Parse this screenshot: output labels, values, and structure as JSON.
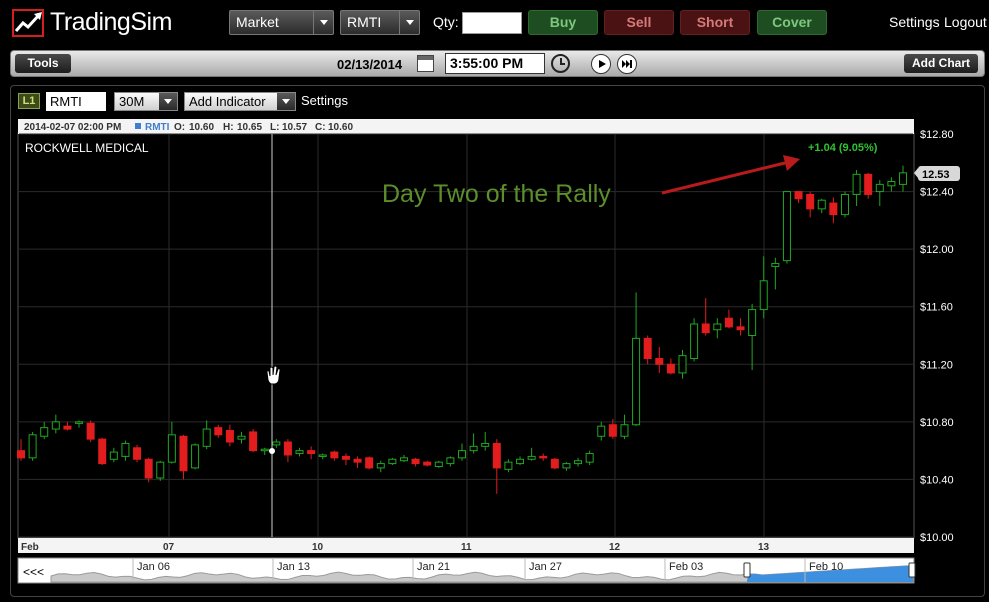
{
  "app": {
    "logo_text": "TradingSim"
  },
  "topbar": {
    "order_type": "Market",
    "symbol": "RMTI",
    "qty_label": "Qty:",
    "qty_value": "",
    "buy_label": "Buy",
    "sell_label": "Sell",
    "short_label": "Short",
    "cover_label": "Cover",
    "settings_label": "Settings",
    "logout_label": "Logout"
  },
  "toolbar": {
    "tools_label": "Tools",
    "date": "02/13/2014",
    "time": "3:55:00 PM",
    "add_chart_label": "Add Chart"
  },
  "chart_controls": {
    "level_badge": "L1",
    "symbol": "RMTI",
    "interval": "30M",
    "add_indicator_label": "Add Indicator",
    "settings_label": "Settings"
  },
  "chart_info": {
    "datetime": "2014-02-07 02:00 PM",
    "symbol": "RMTI",
    "open_label": "O:",
    "open": "10.60",
    "high_label": "H:",
    "high": "10.65",
    "low_label": "L:",
    "low": "10.57",
    "close_label": "C:",
    "close": "10.60",
    "company_name": "ROCKWELL MEDICAL",
    "change_text": "+1.04 (9.05%)",
    "last_price": "12.53",
    "annotation": "Day Two of the Rally"
  },
  "navigator": {
    "back_label": "<<<",
    "labels": [
      "Jan 06",
      "Jan 13",
      "Jan 21",
      "Jan 27",
      "Feb 03",
      "Feb 10"
    ]
  },
  "colors": {
    "up_candle": "#1fa81f",
    "down_candle": "#e21d1d",
    "annotation_green": "#5c8f2c",
    "arrow_red": "#b81b1b",
    "change_green": "#2ec42e",
    "grid": "#2b2b2b",
    "navigator_fill": "#3d8fe0"
  },
  "chart_data": {
    "type": "candlestick",
    "ylabel": "",
    "ylim": [
      10.0,
      12.8
    ],
    "y_ticks": [
      "$12.80",
      "$12.40",
      "$12.00",
      "$11.60",
      "$11.20",
      "$10.80",
      "$10.40",
      "$10.00"
    ],
    "x_ticks": [
      "Feb",
      "07",
      "10",
      "11",
      "12",
      "13"
    ],
    "grid": true,
    "candles": [
      [
        10.6,
        10.68,
        10.53,
        10.55
      ],
      [
        10.55,
        10.73,
        10.53,
        10.71
      ],
      [
        10.7,
        10.8,
        10.68,
        10.76
      ],
      [
        10.75,
        10.85,
        10.72,
        10.8
      ],
      [
        10.77,
        10.8,
        10.74,
        10.75
      ],
      [
        10.79,
        10.81,
        10.76,
        10.8
      ],
      [
        10.79,
        10.81,
        10.66,
        10.68
      ],
      [
        10.68,
        10.69,
        10.5,
        10.51
      ],
      [
        10.54,
        10.62,
        10.52,
        10.59
      ],
      [
        10.56,
        10.67,
        10.53,
        10.65
      ],
      [
        10.62,
        10.64,
        10.52,
        10.54
      ],
      [
        10.54,
        10.55,
        10.38,
        10.41
      ],
      [
        10.41,
        10.53,
        10.39,
        10.52
      ],
      [
        10.52,
        10.8,
        10.51,
        10.71
      ],
      [
        10.7,
        10.71,
        10.4,
        10.46
      ],
      [
        10.48,
        10.65,
        10.47,
        10.64
      ],
      [
        10.63,
        10.81,
        10.61,
        10.75
      ],
      [
        10.76,
        10.78,
        10.69,
        10.71
      ],
      [
        10.74,
        10.78,
        10.63,
        10.66
      ],
      [
        10.68,
        10.73,
        10.65,
        10.7
      ],
      [
        10.73,
        10.75,
        10.59,
        10.6
      ],
      [
        10.6,
        10.62,
        10.57,
        10.61
      ],
      [
        10.64,
        10.68,
        10.62,
        10.66
      ],
      [
        10.66,
        10.68,
        10.52,
        10.57
      ],
      [
        10.58,
        10.62,
        10.56,
        10.6
      ],
      [
        10.6,
        10.63,
        10.54,
        10.58
      ],
      [
        10.56,
        10.58,
        10.54,
        10.57
      ],
      [
        10.59,
        10.6,
        10.53,
        10.55
      ],
      [
        10.56,
        10.58,
        10.5,
        10.54
      ],
      [
        10.54,
        10.56,
        10.48,
        10.52
      ],
      [
        10.55,
        10.56,
        10.47,
        10.48
      ],
      [
        10.48,
        10.53,
        10.45,
        10.51
      ],
      [
        10.51,
        10.55,
        10.5,
        10.54
      ],
      [
        10.53,
        10.57,
        10.52,
        10.55
      ],
      [
        10.54,
        10.55,
        10.49,
        10.51
      ],
      [
        10.52,
        10.53,
        10.49,
        10.5
      ],
      [
        10.49,
        10.53,
        10.48,
        10.52
      ],
      [
        10.51,
        10.56,
        10.49,
        10.55
      ],
      [
        10.55,
        10.65,
        10.53,
        10.6
      ],
      [
        10.6,
        10.72,
        10.58,
        10.63
      ],
      [
        10.63,
        10.73,
        10.6,
        10.65
      ],
      [
        10.65,
        10.68,
        10.3,
        10.48
      ],
      [
        10.47,
        10.54,
        10.45,
        10.52
      ],
      [
        10.51,
        10.56,
        10.5,
        10.54
      ],
      [
        10.54,
        10.62,
        10.53,
        10.56
      ],
      [
        10.56,
        10.58,
        10.53,
        10.55
      ],
      [
        10.54,
        10.55,
        10.47,
        10.48
      ],
      [
        10.48,
        10.52,
        10.46,
        10.51
      ],
      [
        10.51,
        10.55,
        10.49,
        10.53
      ],
      [
        10.52,
        10.6,
        10.5,
        10.58
      ],
      [
        10.7,
        10.8,
        10.67,
        10.77
      ],
      [
        10.78,
        10.82,
        10.68,
        10.7
      ],
      [
        10.7,
        10.85,
        10.68,
        10.78
      ],
      [
        10.78,
        11.7,
        10.77,
        11.38
      ],
      [
        11.38,
        11.4,
        11.2,
        11.24
      ],
      [
        11.24,
        11.32,
        11.14,
        11.2
      ],
      [
        11.2,
        11.24,
        11.13,
        11.14
      ],
      [
        11.14,
        11.3,
        11.1,
        11.26
      ],
      [
        11.24,
        11.52,
        11.22,
        11.48
      ],
      [
        11.48,
        11.66,
        11.4,
        11.42
      ],
      [
        11.44,
        11.52,
        11.38,
        11.48
      ],
      [
        11.52,
        11.58,
        11.45,
        11.46
      ],
      [
        11.46,
        11.52,
        11.4,
        11.44
      ],
      [
        11.4,
        11.62,
        11.16,
        11.58
      ],
      [
        11.58,
        11.95,
        11.52,
        11.78
      ],
      [
        11.88,
        11.94,
        11.72,
        11.9
      ],
      [
        11.92,
        12.35,
        11.9,
        12.4
      ],
      [
        12.4,
        12.4,
        12.32,
        12.35
      ],
      [
        12.38,
        12.4,
        12.22,
        12.28
      ],
      [
        12.28,
        12.35,
        12.25,
        12.34
      ],
      [
        12.32,
        12.36,
        12.18,
        12.24
      ],
      [
        12.24,
        12.4,
        12.22,
        12.38
      ],
      [
        12.38,
        12.55,
        12.3,
        12.52
      ],
      [
        12.52,
        12.53,
        12.35,
        12.38
      ],
      [
        12.4,
        12.48,
        12.3,
        12.45
      ],
      [
        12.44,
        12.5,
        12.4,
        12.47
      ],
      [
        12.45,
        12.58,
        12.4,
        12.53
      ]
    ]
  }
}
